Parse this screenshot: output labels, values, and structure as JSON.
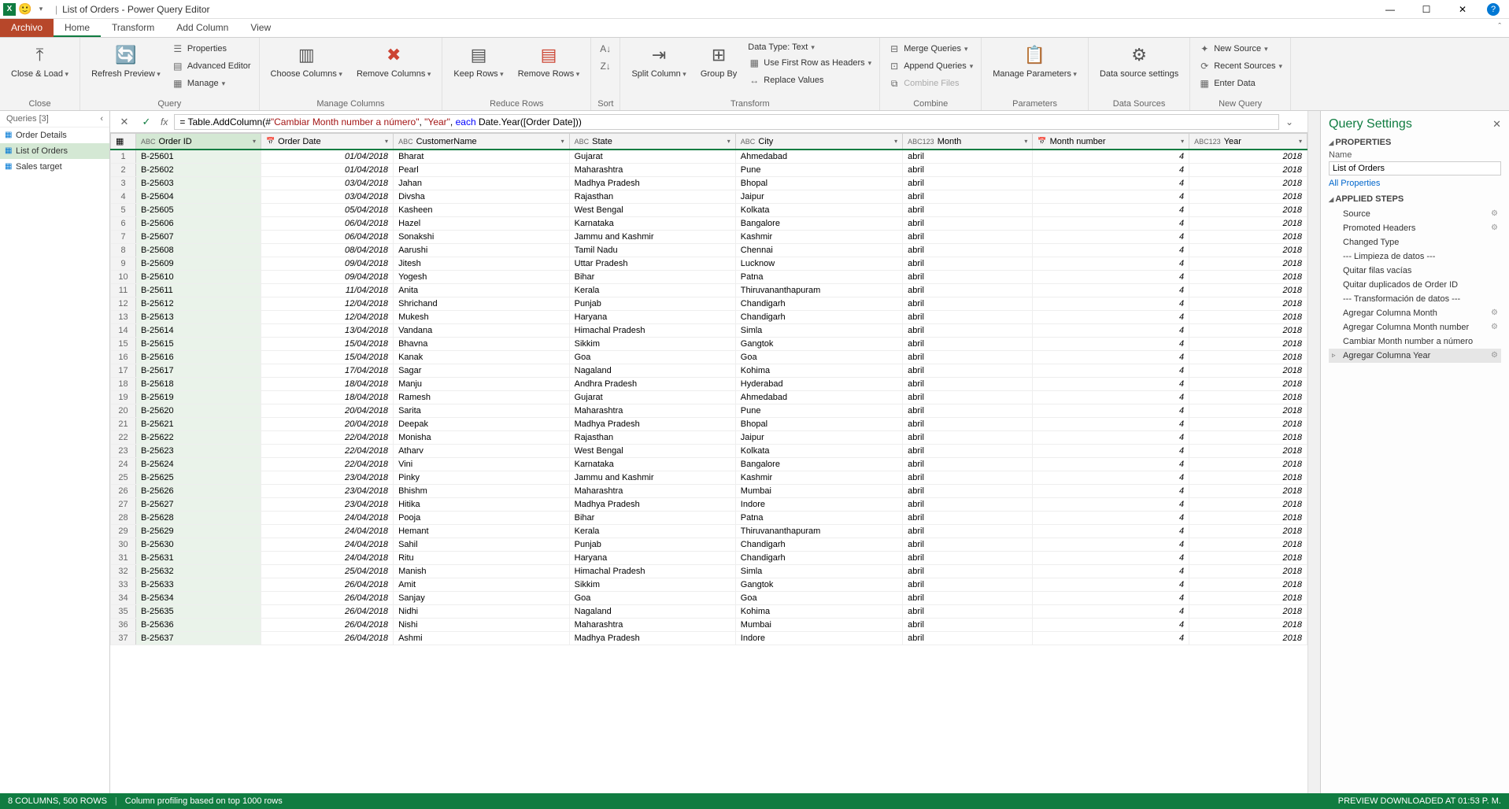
{
  "titlebar": {
    "title": "List of Orders - Power Query Editor"
  },
  "tabs": {
    "archivo": "Archivo",
    "home": "Home",
    "transform": "Transform",
    "addcolumn": "Add Column",
    "view": "View"
  },
  "ribbon": {
    "close_load": "Close &\nLoad",
    "refresh": "Refresh\nPreview",
    "properties": "Properties",
    "advanced": "Advanced Editor",
    "manage": "Manage",
    "choose_cols": "Choose\nColumns",
    "remove_cols": "Remove\nColumns",
    "keep_rows": "Keep\nRows",
    "remove_rows": "Remove\nRows",
    "sort_asc": "",
    "sort_desc": "",
    "split": "Split\nColumn",
    "group": "Group\nBy",
    "datatype": "Data Type: Text",
    "first_row": "Use First Row as Headers",
    "replace": "Replace Values",
    "merge": "Merge Queries",
    "append": "Append Queries",
    "combine_files": "Combine Files",
    "manage_params": "Manage\nParameters",
    "ds_settings": "Data source\nsettings",
    "new_source": "New Source",
    "recent_sources": "Recent Sources",
    "enter_data": "Enter Data",
    "g_close": "Close",
    "g_query": "Query",
    "g_manage": "Manage Columns",
    "g_reduce": "Reduce Rows",
    "g_sort": "Sort",
    "g_transform": "Transform",
    "g_combine": "Combine",
    "g_params": "Parameters",
    "g_ds": "Data Sources",
    "g_new": "New Query"
  },
  "queries": {
    "header": "Queries [3]",
    "items": [
      "Order Details",
      "List of Orders",
      "Sales target"
    ],
    "selected_index": 1
  },
  "formula": {
    "prefix": "= Table.AddColumn(#",
    "arg1": "\"Cambiar Month number a número\"",
    "sep1": ", ",
    "arg2": "\"Year\"",
    "sep2": ", ",
    "each": "each",
    "rest": " Date.Year([Order Date]))"
  },
  "columns": [
    {
      "name": "Order ID",
      "type": "ABC"
    },
    {
      "name": "Order Date",
      "type": "📅"
    },
    {
      "name": "CustomerName",
      "type": "ABC"
    },
    {
      "name": "State",
      "type": "ABC"
    },
    {
      "name": "City",
      "type": "ABC"
    },
    {
      "name": "Month",
      "type": "ABC123"
    },
    {
      "name": "Month number",
      "type": "📅"
    },
    {
      "name": "Year",
      "type": "ABC123"
    }
  ],
  "rows": [
    [
      "B-25601",
      "01/04/2018",
      "Bharat",
      "Gujarat",
      "Ahmedabad",
      "abril",
      "4",
      "2018"
    ],
    [
      "B-25602",
      "01/04/2018",
      "Pearl",
      "Maharashtra",
      "Pune",
      "abril",
      "4",
      "2018"
    ],
    [
      "B-25603",
      "03/04/2018",
      "Jahan",
      "Madhya Pradesh",
      "Bhopal",
      "abril",
      "4",
      "2018"
    ],
    [
      "B-25604",
      "03/04/2018",
      "Divsha",
      "Rajasthan",
      "Jaipur",
      "abril",
      "4",
      "2018"
    ],
    [
      "B-25605",
      "05/04/2018",
      "Kasheen",
      "West Bengal",
      "Kolkata",
      "abril",
      "4",
      "2018"
    ],
    [
      "B-25606",
      "06/04/2018",
      "Hazel",
      "Karnataka",
      "Bangalore",
      "abril",
      "4",
      "2018"
    ],
    [
      "B-25607",
      "06/04/2018",
      "Sonakshi",
      "Jammu and Kashmir",
      "Kashmir",
      "abril",
      "4",
      "2018"
    ],
    [
      "B-25608",
      "08/04/2018",
      "Aarushi",
      "Tamil Nadu",
      "Chennai",
      "abril",
      "4",
      "2018"
    ],
    [
      "B-25609",
      "09/04/2018",
      "Jitesh",
      "Uttar Pradesh",
      "Lucknow",
      "abril",
      "4",
      "2018"
    ],
    [
      "B-25610",
      "09/04/2018",
      "Yogesh",
      "Bihar",
      "Patna",
      "abril",
      "4",
      "2018"
    ],
    [
      "B-25611",
      "11/04/2018",
      "Anita",
      "Kerala",
      "Thiruvananthapuram",
      "abril",
      "4",
      "2018"
    ],
    [
      "B-25612",
      "12/04/2018",
      "Shrichand",
      "Punjab",
      "Chandigarh",
      "abril",
      "4",
      "2018"
    ],
    [
      "B-25613",
      "12/04/2018",
      "Mukesh",
      "Haryana",
      "Chandigarh",
      "abril",
      "4",
      "2018"
    ],
    [
      "B-25614",
      "13/04/2018",
      "Vandana",
      "Himachal Pradesh",
      "Simla",
      "abril",
      "4",
      "2018"
    ],
    [
      "B-25615",
      "15/04/2018",
      "Bhavna",
      "Sikkim",
      "Gangtok",
      "abril",
      "4",
      "2018"
    ],
    [
      "B-25616",
      "15/04/2018",
      "Kanak",
      "Goa",
      "Goa",
      "abril",
      "4",
      "2018"
    ],
    [
      "B-25617",
      "17/04/2018",
      "Sagar",
      "Nagaland",
      "Kohima",
      "abril",
      "4",
      "2018"
    ],
    [
      "B-25618",
      "18/04/2018",
      "Manju",
      "Andhra Pradesh",
      "Hyderabad",
      "abril",
      "4",
      "2018"
    ],
    [
      "B-25619",
      "18/04/2018",
      "Ramesh",
      "Gujarat",
      "Ahmedabad",
      "abril",
      "4",
      "2018"
    ],
    [
      "B-25620",
      "20/04/2018",
      "Sarita",
      "Maharashtra",
      "Pune",
      "abril",
      "4",
      "2018"
    ],
    [
      "B-25621",
      "20/04/2018",
      "Deepak",
      "Madhya Pradesh",
      "Bhopal",
      "abril",
      "4",
      "2018"
    ],
    [
      "B-25622",
      "22/04/2018",
      "Monisha",
      "Rajasthan",
      "Jaipur",
      "abril",
      "4",
      "2018"
    ],
    [
      "B-25623",
      "22/04/2018",
      "Atharv",
      "West Bengal",
      "Kolkata",
      "abril",
      "4",
      "2018"
    ],
    [
      "B-25624",
      "22/04/2018",
      "Vini",
      "Karnataka",
      "Bangalore",
      "abril",
      "4",
      "2018"
    ],
    [
      "B-25625",
      "23/04/2018",
      "Pinky",
      "Jammu and Kashmir",
      "Kashmir",
      "abril",
      "4",
      "2018"
    ],
    [
      "B-25626",
      "23/04/2018",
      "Bhishm",
      "Maharashtra",
      "Mumbai",
      "abril",
      "4",
      "2018"
    ],
    [
      "B-25627",
      "23/04/2018",
      "Hitika",
      "Madhya Pradesh",
      "Indore",
      "abril",
      "4",
      "2018"
    ],
    [
      "B-25628",
      "24/04/2018",
      "Pooja",
      "Bihar",
      "Patna",
      "abril",
      "4",
      "2018"
    ],
    [
      "B-25629",
      "24/04/2018",
      "Hemant",
      "Kerala",
      "Thiruvananthapuram",
      "abril",
      "4",
      "2018"
    ],
    [
      "B-25630",
      "24/04/2018",
      "Sahil",
      "Punjab",
      "Chandigarh",
      "abril",
      "4",
      "2018"
    ],
    [
      "B-25631",
      "24/04/2018",
      "Ritu",
      "Haryana",
      "Chandigarh",
      "abril",
      "4",
      "2018"
    ],
    [
      "B-25632",
      "25/04/2018",
      "Manish",
      "Himachal Pradesh",
      "Simla",
      "abril",
      "4",
      "2018"
    ],
    [
      "B-25633",
      "26/04/2018",
      "Amit",
      "Sikkim",
      "Gangtok",
      "abril",
      "4",
      "2018"
    ],
    [
      "B-25634",
      "26/04/2018",
      "Sanjay",
      "Goa",
      "Goa",
      "abril",
      "4",
      "2018"
    ],
    [
      "B-25635",
      "26/04/2018",
      "Nidhi",
      "Nagaland",
      "Kohima",
      "abril",
      "4",
      "2018"
    ],
    [
      "B-25636",
      "26/04/2018",
      "Nishi",
      "Maharashtra",
      "Mumbai",
      "abril",
      "4",
      "2018"
    ],
    [
      "B-25637",
      "26/04/2018",
      "Ashmi",
      "Madhya Pradesh",
      "Indore",
      "abril",
      "4",
      "2018"
    ]
  ],
  "settings": {
    "title": "Query Settings",
    "properties_label": "PROPERTIES",
    "name_label": "Name",
    "name_value": "List of Orders",
    "all_properties": "All Properties",
    "steps_label": "APPLIED STEPS",
    "steps": [
      {
        "name": "Source",
        "gear": true
      },
      {
        "name": "Promoted Headers",
        "gear": true
      },
      {
        "name": "Changed Type",
        "gear": false
      },
      {
        "name": "--- Limpieza de datos ---",
        "gear": false
      },
      {
        "name": "Quitar filas vacías",
        "gear": false
      },
      {
        "name": "Quitar duplicados de Order ID",
        "gear": false
      },
      {
        "name": "--- Transformación de datos ---",
        "gear": false
      },
      {
        "name": "Agregar Columna Month",
        "gear": true
      },
      {
        "name": "Agregar Columna Month number",
        "gear": true
      },
      {
        "name": "Cambiar Month number a número",
        "gear": false
      },
      {
        "name": "Agregar Columna Year",
        "gear": true
      }
    ],
    "selected_step_index": 10
  },
  "statusbar": {
    "left1": "8 COLUMNS, 500 ROWS",
    "left2": "Column profiling based on top 1000 rows",
    "right": "PREVIEW DOWNLOADED AT 01:53 P. M."
  }
}
